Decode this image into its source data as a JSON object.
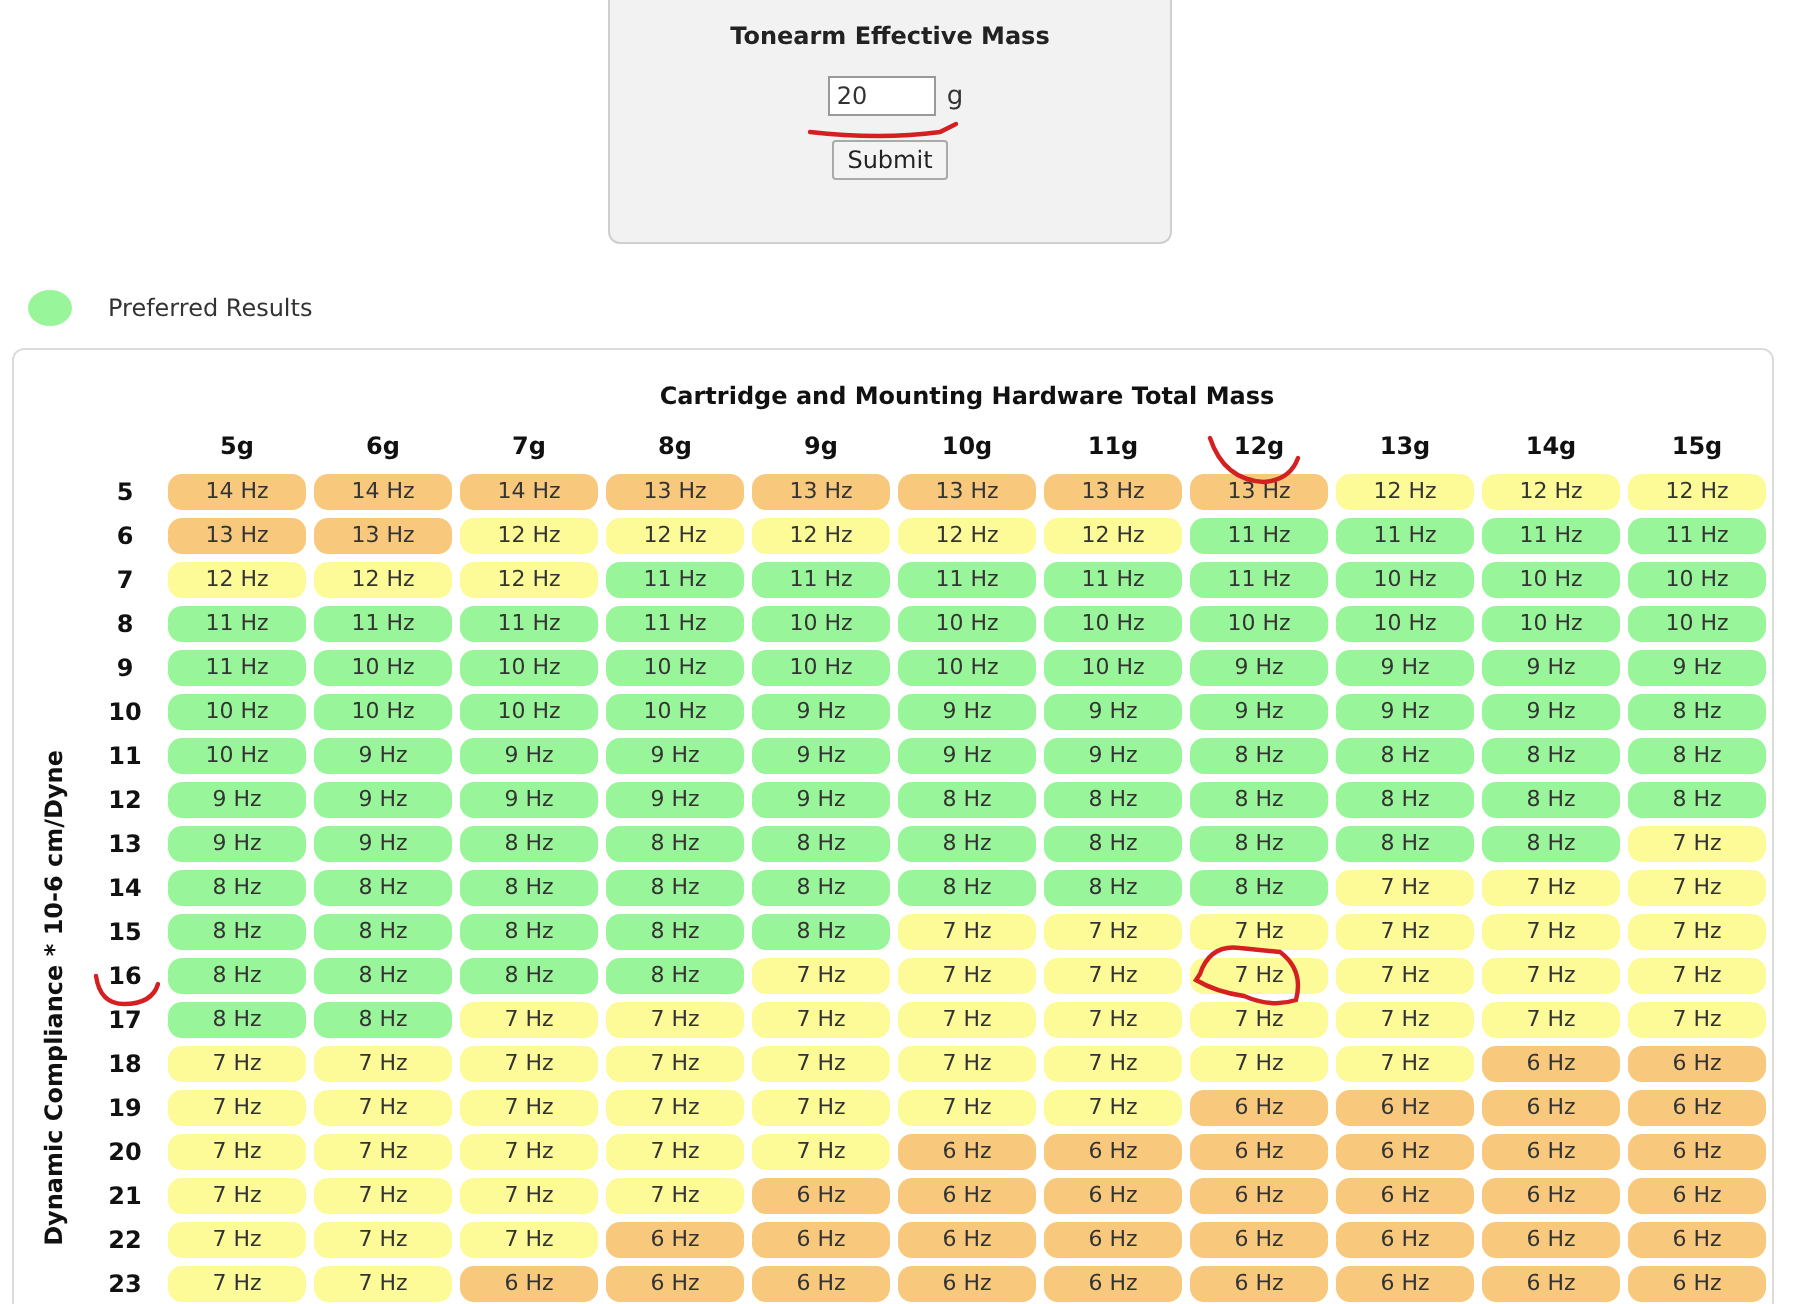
{
  "mass_form": {
    "title": "Tonearm Effective Mass",
    "value": "20",
    "unit": "g",
    "button": "Submit"
  },
  "legend": {
    "label": "Preferred Results",
    "color": "#99f599"
  },
  "table": {
    "title": "Cartridge and Mounting Hardware Total Mass",
    "axis_label": "Dynamic Compliance * 10-6 cm/Dyne",
    "columns": [
      "5g",
      "6g",
      "7g",
      "8g",
      "9g",
      "10g",
      "11g",
      "12g",
      "13g",
      "14g",
      "15g"
    ],
    "rows": [
      {
        "label": "5",
        "cells": [
          {
            "text": "14 Hz",
            "color": "#f8c87c"
          },
          {
            "text": "14 Hz",
            "color": "#f8c87c"
          },
          {
            "text": "14 Hz",
            "color": "#f8c87c"
          },
          {
            "text": "13 Hz",
            "color": "#f8c87c"
          },
          {
            "text": "13 Hz",
            "color": "#f8c87c"
          },
          {
            "text": "13 Hz",
            "color": "#f8c87c"
          },
          {
            "text": "13 Hz",
            "color": "#f8c87c"
          },
          {
            "text": "13 Hz",
            "color": "#f8c87c"
          },
          {
            "text": "12 Hz",
            "color": "#fdfa98"
          },
          {
            "text": "12 Hz",
            "color": "#fdfa98"
          },
          {
            "text": "12 Hz",
            "color": "#fdfa98"
          }
        ]
      },
      {
        "label": "6",
        "cells": [
          {
            "text": "13 Hz",
            "color": "#f8c87c"
          },
          {
            "text": "13 Hz",
            "color": "#f8c87c"
          },
          {
            "text": "12 Hz",
            "color": "#fdfa98"
          },
          {
            "text": "12 Hz",
            "color": "#fdfa98"
          },
          {
            "text": "12 Hz",
            "color": "#fdfa98"
          },
          {
            "text": "12 Hz",
            "color": "#fdfa98"
          },
          {
            "text": "12 Hz",
            "color": "#fdfa98"
          },
          {
            "text": "11 Hz",
            "color": "#99f599"
          },
          {
            "text": "11 Hz",
            "color": "#99f599"
          },
          {
            "text": "11 Hz",
            "color": "#99f599"
          },
          {
            "text": "11 Hz",
            "color": "#99f599"
          }
        ]
      },
      {
        "label": "7",
        "cells": [
          {
            "text": "12 Hz",
            "color": "#fdfa98"
          },
          {
            "text": "12 Hz",
            "color": "#fdfa98"
          },
          {
            "text": "12 Hz",
            "color": "#fdfa98"
          },
          {
            "text": "11 Hz",
            "color": "#99f599"
          },
          {
            "text": "11 Hz",
            "color": "#99f599"
          },
          {
            "text": "11 Hz",
            "color": "#99f599"
          },
          {
            "text": "11 Hz",
            "color": "#99f599"
          },
          {
            "text": "11 Hz",
            "color": "#99f599"
          },
          {
            "text": "10 Hz",
            "color": "#99f599"
          },
          {
            "text": "10 Hz",
            "color": "#99f599"
          },
          {
            "text": "10 Hz",
            "color": "#99f599"
          }
        ]
      },
      {
        "label": "8",
        "cells": [
          {
            "text": "11 Hz",
            "color": "#99f599"
          },
          {
            "text": "11 Hz",
            "color": "#99f599"
          },
          {
            "text": "11 Hz",
            "color": "#99f599"
          },
          {
            "text": "11 Hz",
            "color": "#99f599"
          },
          {
            "text": "10 Hz",
            "color": "#99f599"
          },
          {
            "text": "10 Hz",
            "color": "#99f599"
          },
          {
            "text": "10 Hz",
            "color": "#99f599"
          },
          {
            "text": "10 Hz",
            "color": "#99f599"
          },
          {
            "text": "10 Hz",
            "color": "#99f599"
          },
          {
            "text": "10 Hz",
            "color": "#99f599"
          },
          {
            "text": "10 Hz",
            "color": "#99f599"
          }
        ]
      },
      {
        "label": "9",
        "cells": [
          {
            "text": "11 Hz",
            "color": "#99f599"
          },
          {
            "text": "10 Hz",
            "color": "#99f599"
          },
          {
            "text": "10 Hz",
            "color": "#99f599"
          },
          {
            "text": "10 Hz",
            "color": "#99f599"
          },
          {
            "text": "10 Hz",
            "color": "#99f599"
          },
          {
            "text": "10 Hz",
            "color": "#99f599"
          },
          {
            "text": "10 Hz",
            "color": "#99f599"
          },
          {
            "text": "9 Hz",
            "color": "#99f599"
          },
          {
            "text": "9 Hz",
            "color": "#99f599"
          },
          {
            "text": "9 Hz",
            "color": "#99f599"
          },
          {
            "text": "9 Hz",
            "color": "#99f599"
          }
        ]
      },
      {
        "label": "10",
        "cells": [
          {
            "text": "10 Hz",
            "color": "#99f599"
          },
          {
            "text": "10 Hz",
            "color": "#99f599"
          },
          {
            "text": "10 Hz",
            "color": "#99f599"
          },
          {
            "text": "10 Hz",
            "color": "#99f599"
          },
          {
            "text": "9 Hz",
            "color": "#99f599"
          },
          {
            "text": "9 Hz",
            "color": "#99f599"
          },
          {
            "text": "9 Hz",
            "color": "#99f599"
          },
          {
            "text": "9 Hz",
            "color": "#99f599"
          },
          {
            "text": "9 Hz",
            "color": "#99f599"
          },
          {
            "text": "9 Hz",
            "color": "#99f599"
          },
          {
            "text": "8 Hz",
            "color": "#99f599"
          }
        ]
      },
      {
        "label": "11",
        "cells": [
          {
            "text": "10 Hz",
            "color": "#99f599"
          },
          {
            "text": "9 Hz",
            "color": "#99f599"
          },
          {
            "text": "9 Hz",
            "color": "#99f599"
          },
          {
            "text": "9 Hz",
            "color": "#99f599"
          },
          {
            "text": "9 Hz",
            "color": "#99f599"
          },
          {
            "text": "9 Hz",
            "color": "#99f599"
          },
          {
            "text": "9 Hz",
            "color": "#99f599"
          },
          {
            "text": "8 Hz",
            "color": "#99f599"
          },
          {
            "text": "8 Hz",
            "color": "#99f599"
          },
          {
            "text": "8 Hz",
            "color": "#99f599"
          },
          {
            "text": "8 Hz",
            "color": "#99f599"
          }
        ]
      },
      {
        "label": "12",
        "cells": [
          {
            "text": "9 Hz",
            "color": "#99f599"
          },
          {
            "text": "9 Hz",
            "color": "#99f599"
          },
          {
            "text": "9 Hz",
            "color": "#99f599"
          },
          {
            "text": "9 Hz",
            "color": "#99f599"
          },
          {
            "text": "9 Hz",
            "color": "#99f599"
          },
          {
            "text": "8 Hz",
            "color": "#99f599"
          },
          {
            "text": "8 Hz",
            "color": "#99f599"
          },
          {
            "text": "8 Hz",
            "color": "#99f599"
          },
          {
            "text": "8 Hz",
            "color": "#99f599"
          },
          {
            "text": "8 Hz",
            "color": "#99f599"
          },
          {
            "text": "8 Hz",
            "color": "#99f599"
          }
        ]
      },
      {
        "label": "13",
        "cells": [
          {
            "text": "9 Hz",
            "color": "#99f599"
          },
          {
            "text": "9 Hz",
            "color": "#99f599"
          },
          {
            "text": "8 Hz",
            "color": "#99f599"
          },
          {
            "text": "8 Hz",
            "color": "#99f599"
          },
          {
            "text": "8 Hz",
            "color": "#99f599"
          },
          {
            "text": "8 Hz",
            "color": "#99f599"
          },
          {
            "text": "8 Hz",
            "color": "#99f599"
          },
          {
            "text": "8 Hz",
            "color": "#99f599"
          },
          {
            "text": "8 Hz",
            "color": "#99f599"
          },
          {
            "text": "8 Hz",
            "color": "#99f599"
          },
          {
            "text": "7 Hz",
            "color": "#fdfa98"
          }
        ]
      },
      {
        "label": "14",
        "cells": [
          {
            "text": "8 Hz",
            "color": "#99f599"
          },
          {
            "text": "8 Hz",
            "color": "#99f599"
          },
          {
            "text": "8 Hz",
            "color": "#99f599"
          },
          {
            "text": "8 Hz",
            "color": "#99f599"
          },
          {
            "text": "8 Hz",
            "color": "#99f599"
          },
          {
            "text": "8 Hz",
            "color": "#99f599"
          },
          {
            "text": "8 Hz",
            "color": "#99f599"
          },
          {
            "text": "8 Hz",
            "color": "#99f599"
          },
          {
            "text": "7 Hz",
            "color": "#fdfa98"
          },
          {
            "text": "7 Hz",
            "color": "#fdfa98"
          },
          {
            "text": "7 Hz",
            "color": "#fdfa98"
          }
        ]
      },
      {
        "label": "15",
        "cells": [
          {
            "text": "8 Hz",
            "color": "#99f599"
          },
          {
            "text": "8 Hz",
            "color": "#99f599"
          },
          {
            "text": "8 Hz",
            "color": "#99f599"
          },
          {
            "text": "8 Hz",
            "color": "#99f599"
          },
          {
            "text": "8 Hz",
            "color": "#99f599"
          },
          {
            "text": "7 Hz",
            "color": "#fdfa98"
          },
          {
            "text": "7 Hz",
            "color": "#fdfa98"
          },
          {
            "text": "7 Hz",
            "color": "#fdfa98"
          },
          {
            "text": "7 Hz",
            "color": "#fdfa98"
          },
          {
            "text": "7 Hz",
            "color": "#fdfa98"
          },
          {
            "text": "7 Hz",
            "color": "#fdfa98"
          }
        ]
      },
      {
        "label": "16",
        "cells": [
          {
            "text": "8 Hz",
            "color": "#99f599"
          },
          {
            "text": "8 Hz",
            "color": "#99f599"
          },
          {
            "text": "8 Hz",
            "color": "#99f599"
          },
          {
            "text": "8 Hz",
            "color": "#99f599"
          },
          {
            "text": "7 Hz",
            "color": "#fdfa98"
          },
          {
            "text": "7 Hz",
            "color": "#fdfa98"
          },
          {
            "text": "7 Hz",
            "color": "#fdfa98"
          },
          {
            "text": "7 Hz",
            "color": "#fdfa98"
          },
          {
            "text": "7 Hz",
            "color": "#fdfa98"
          },
          {
            "text": "7 Hz",
            "color": "#fdfa98"
          },
          {
            "text": "7 Hz",
            "color": "#fdfa98"
          }
        ]
      },
      {
        "label": "17",
        "cells": [
          {
            "text": "8 Hz",
            "color": "#99f599"
          },
          {
            "text": "8 Hz",
            "color": "#99f599"
          },
          {
            "text": "7 Hz",
            "color": "#fdfa98"
          },
          {
            "text": "7 Hz",
            "color": "#fdfa98"
          },
          {
            "text": "7 Hz",
            "color": "#fdfa98"
          },
          {
            "text": "7 Hz",
            "color": "#fdfa98"
          },
          {
            "text": "7 Hz",
            "color": "#fdfa98"
          },
          {
            "text": "7 Hz",
            "color": "#fdfa98"
          },
          {
            "text": "7 Hz",
            "color": "#fdfa98"
          },
          {
            "text": "7 Hz",
            "color": "#fdfa98"
          },
          {
            "text": "7 Hz",
            "color": "#fdfa98"
          }
        ]
      },
      {
        "label": "18",
        "cells": [
          {
            "text": "7 Hz",
            "color": "#fdfa98"
          },
          {
            "text": "7 Hz",
            "color": "#fdfa98"
          },
          {
            "text": "7 Hz",
            "color": "#fdfa98"
          },
          {
            "text": "7 Hz",
            "color": "#fdfa98"
          },
          {
            "text": "7 Hz",
            "color": "#fdfa98"
          },
          {
            "text": "7 Hz",
            "color": "#fdfa98"
          },
          {
            "text": "7 Hz",
            "color": "#fdfa98"
          },
          {
            "text": "7 Hz",
            "color": "#fdfa98"
          },
          {
            "text": "7 Hz",
            "color": "#fdfa98"
          },
          {
            "text": "6 Hz",
            "color": "#f8c87c"
          },
          {
            "text": "6 Hz",
            "color": "#f8c87c"
          }
        ]
      },
      {
        "label": "19",
        "cells": [
          {
            "text": "7 Hz",
            "color": "#fdfa98"
          },
          {
            "text": "7 Hz",
            "color": "#fdfa98"
          },
          {
            "text": "7 Hz",
            "color": "#fdfa98"
          },
          {
            "text": "7 Hz",
            "color": "#fdfa98"
          },
          {
            "text": "7 Hz",
            "color": "#fdfa98"
          },
          {
            "text": "7 Hz",
            "color": "#fdfa98"
          },
          {
            "text": "7 Hz",
            "color": "#fdfa98"
          },
          {
            "text": "6 Hz",
            "color": "#f8c87c"
          },
          {
            "text": "6 Hz",
            "color": "#f8c87c"
          },
          {
            "text": "6 Hz",
            "color": "#f8c87c"
          },
          {
            "text": "6 Hz",
            "color": "#f8c87c"
          }
        ]
      },
      {
        "label": "20",
        "cells": [
          {
            "text": "7 Hz",
            "color": "#fdfa98"
          },
          {
            "text": "7 Hz",
            "color": "#fdfa98"
          },
          {
            "text": "7 Hz",
            "color": "#fdfa98"
          },
          {
            "text": "7 Hz",
            "color": "#fdfa98"
          },
          {
            "text": "7 Hz",
            "color": "#fdfa98"
          },
          {
            "text": "6 Hz",
            "color": "#f8c87c"
          },
          {
            "text": "6 Hz",
            "color": "#f8c87c"
          },
          {
            "text": "6 Hz",
            "color": "#f8c87c"
          },
          {
            "text": "6 Hz",
            "color": "#f8c87c"
          },
          {
            "text": "6 Hz",
            "color": "#f8c87c"
          },
          {
            "text": "6 Hz",
            "color": "#f8c87c"
          }
        ]
      },
      {
        "label": "21",
        "cells": [
          {
            "text": "7 Hz",
            "color": "#fdfa98"
          },
          {
            "text": "7 Hz",
            "color": "#fdfa98"
          },
          {
            "text": "7 Hz",
            "color": "#fdfa98"
          },
          {
            "text": "7 Hz",
            "color": "#fdfa98"
          },
          {
            "text": "6 Hz",
            "color": "#f8c87c"
          },
          {
            "text": "6 Hz",
            "color": "#f8c87c"
          },
          {
            "text": "6 Hz",
            "color": "#f8c87c"
          },
          {
            "text": "6 Hz",
            "color": "#f8c87c"
          },
          {
            "text": "6 Hz",
            "color": "#f8c87c"
          },
          {
            "text": "6 Hz",
            "color": "#f8c87c"
          },
          {
            "text": "6 Hz",
            "color": "#f8c87c"
          }
        ]
      },
      {
        "label": "22",
        "cells": [
          {
            "text": "7 Hz",
            "color": "#fdfa98"
          },
          {
            "text": "7 Hz",
            "color": "#fdfa98"
          },
          {
            "text": "7 Hz",
            "color": "#fdfa98"
          },
          {
            "text": "6 Hz",
            "color": "#f8c87c"
          },
          {
            "text": "6 Hz",
            "color": "#f8c87c"
          },
          {
            "text": "6 Hz",
            "color": "#f8c87c"
          },
          {
            "text": "6 Hz",
            "color": "#f8c87c"
          },
          {
            "text": "6 Hz",
            "color": "#f8c87c"
          },
          {
            "text": "6 Hz",
            "color": "#f8c87c"
          },
          {
            "text": "6 Hz",
            "color": "#f8c87c"
          },
          {
            "text": "6 Hz",
            "color": "#f8c87c"
          }
        ]
      },
      {
        "label": "23",
        "cells": [
          {
            "text": "7 Hz",
            "color": "#fdfa98"
          },
          {
            "text": "7 Hz",
            "color": "#fdfa98"
          },
          {
            "text": "6 Hz",
            "color": "#f8c87c"
          },
          {
            "text": "6 Hz",
            "color": "#f8c87c"
          },
          {
            "text": "6 Hz",
            "color": "#f8c87c"
          },
          {
            "text": "6 Hz",
            "color": "#f8c87c"
          },
          {
            "text": "6 Hz",
            "color": "#f8c87c"
          },
          {
            "text": "6 Hz",
            "color": "#f8c87c"
          },
          {
            "text": "6 Hz",
            "color": "#f8c87c"
          },
          {
            "text": "6 Hz",
            "color": "#f8c87c"
          },
          {
            "text": "6 Hz",
            "color": "#f8c87c"
          }
        ]
      }
    ]
  },
  "annotations": [
    {
      "kind": "underline"
    },
    {
      "kind": "arc"
    },
    {
      "kind": "bracket"
    },
    {
      "kind": "circle"
    }
  ]
}
